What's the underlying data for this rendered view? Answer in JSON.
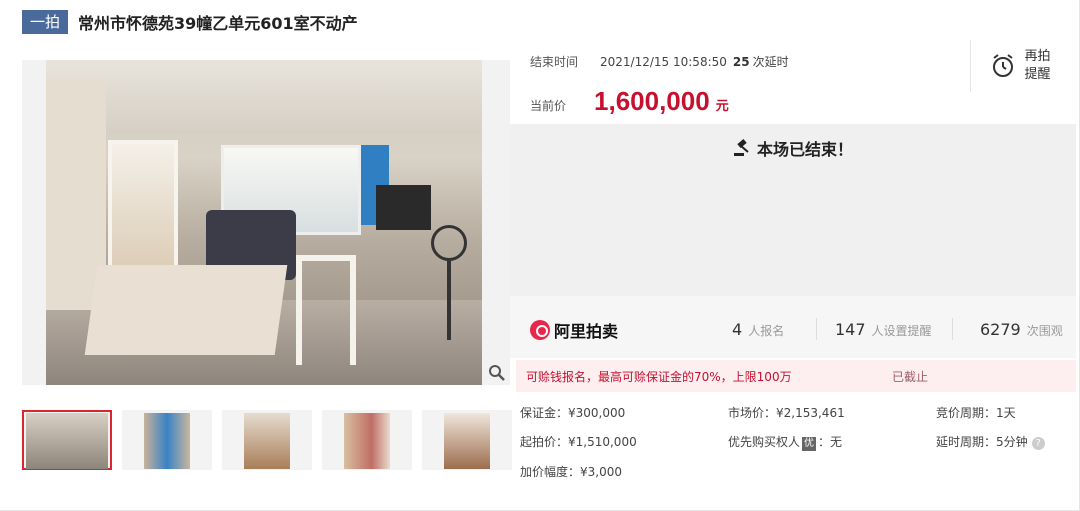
{
  "header": {
    "tag": "一拍",
    "title": "常州市怀德苑39幢乙单元601室不动产"
  },
  "auction": {
    "end_time_label": "结束时间",
    "end_time": "2021/12/15 10:58:50",
    "delay_count": "25",
    "delay_label": "次延时",
    "price_label": "当前价",
    "price": "1,600,000",
    "price_unit": "元",
    "remind_line1": "再拍",
    "remind_line2": "提醒",
    "ended_text": "本场已结束！"
  },
  "stats": {
    "logo_text": "阿里拍卖",
    "signups": "4",
    "signups_label": "人报名",
    "reminders": "147",
    "reminders_label": "人设置提醒",
    "views": "6279",
    "views_label": "次围观"
  },
  "notice": {
    "text": "可赊钱报名，最高可赊保证金的70%，上限100万",
    "status": "已截止"
  },
  "details": {
    "deposit": "保证金：¥300,000",
    "market_price": "市场价：¥2,153,461",
    "bid_cycle": "竞价周期：1天",
    "start_price": "起拍价：¥1,510,000",
    "priority_label": "优先购买权人",
    "priority_icon": "优",
    "priority_value": "：无",
    "delay_cycle": "延时周期：5分钟",
    "increment": "加价幅度：¥3,000"
  },
  "icons": {
    "zoom": "zoom-icon",
    "clock": "alarm-clock-icon",
    "gavel": "gavel-icon",
    "help": "help-icon"
  },
  "colors": {
    "accent": "#c8102e",
    "tag_bg": "#4a6a9b",
    "active_thumb_border": "#d9272e"
  }
}
